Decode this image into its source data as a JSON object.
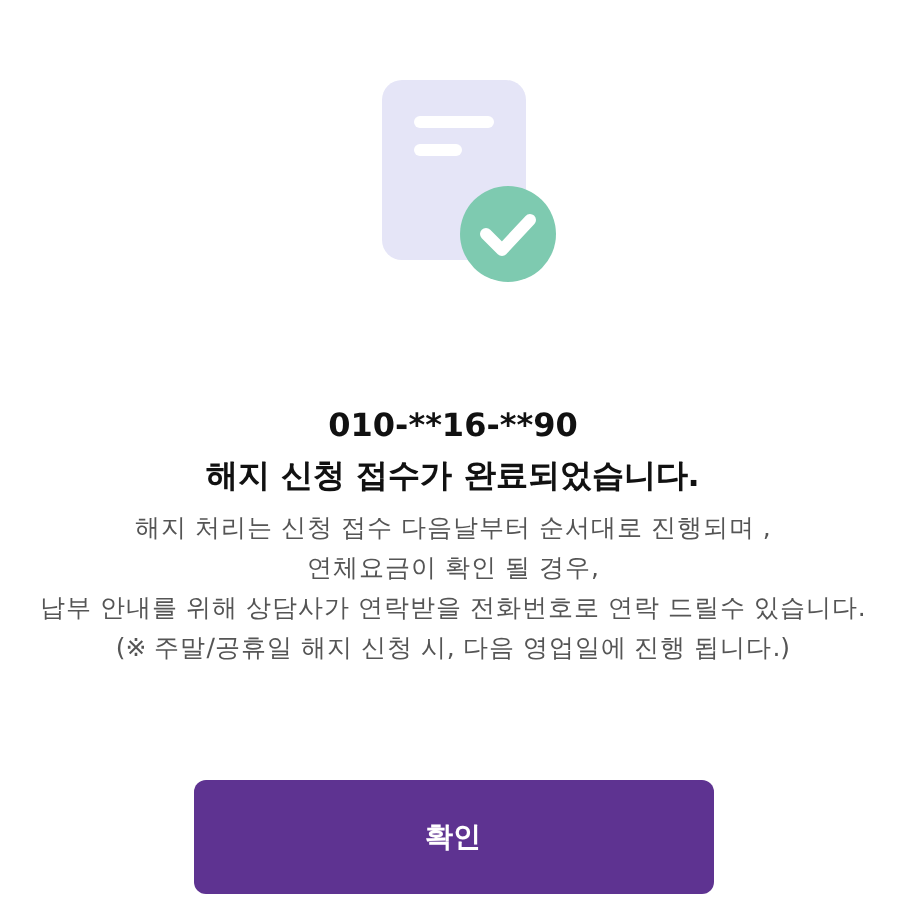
{
  "phone": "010-**16-**90",
  "title": "해지 신청 접수가 완료되었습니다.",
  "description_lines": [
    "해지 처리는 신청 접수 다음날부터 순서대로 진행되며 ,",
    "연체요금이 확인 될 경우,",
    "납부 안내를 위해 상담사가 연락받을 전화번호로 연락 드릴수 있습니다.",
    "(※ 주말/공휴일 해지 신청 시, 다음 영업일에 진행 됩니다.)"
  ],
  "confirm_button": "확인"
}
